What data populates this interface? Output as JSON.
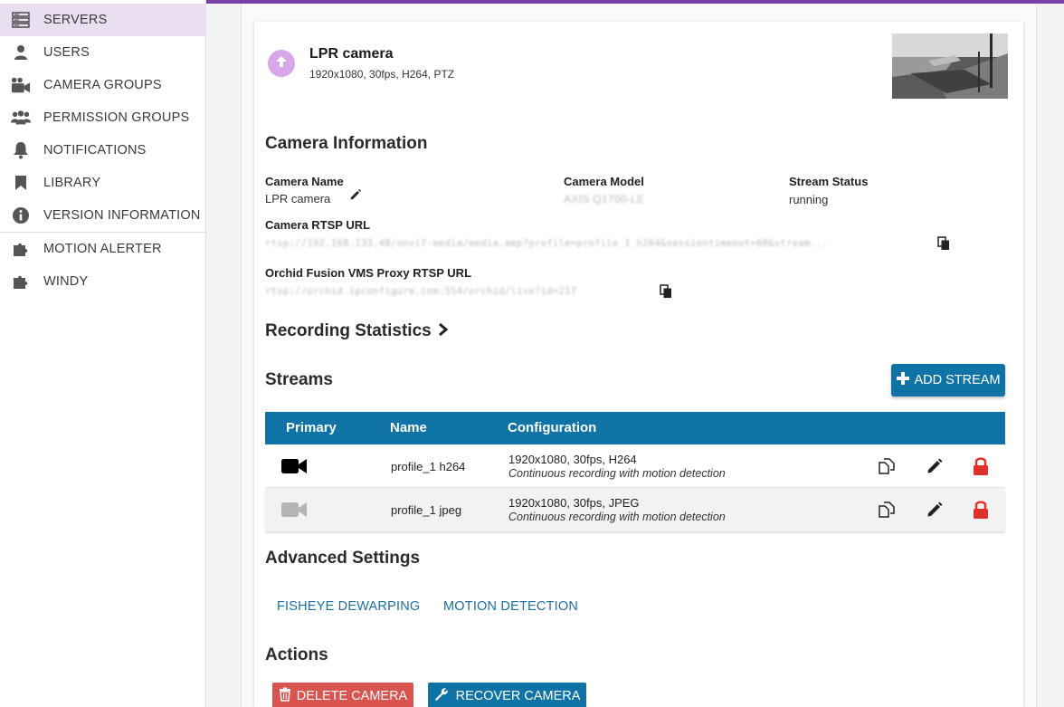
{
  "sidebar": {
    "items": [
      {
        "label": "SERVERS",
        "icon": "servers-icon",
        "active": true
      },
      {
        "label": "USERS",
        "icon": "user-icon"
      },
      {
        "label": "CAMERA GROUPS",
        "icon": "camera-groups-icon"
      },
      {
        "label": "PERMISSION GROUPS",
        "icon": "people-icon"
      },
      {
        "label": "NOTIFICATIONS",
        "icon": "bell-icon"
      },
      {
        "label": "LIBRARY",
        "icon": "bookmark-icon"
      },
      {
        "label": "VERSION INFORMATION",
        "icon": "info-icon"
      },
      {
        "label": "MOTION ALERTER",
        "icon": "puzzle-icon"
      },
      {
        "label": "WINDY",
        "icon": "puzzle-icon"
      }
    ]
  },
  "camera": {
    "name": "LPR camera",
    "summary": "1920x1080, 30fps, H264, PTZ"
  },
  "info": {
    "heading": "Camera Information",
    "name_label": "Camera Name",
    "name_value": "LPR camera",
    "model_label": "Camera Model",
    "model_value": "AXIS Q1700-LE",
    "status_label": "Stream Status",
    "status_value": "running",
    "rtsp_label": "Camera RTSP URL",
    "rtsp_value": "rtsp://192.168.133.48/onvif-media/media.amp?profile=profile_1_h264&sessiontimeout=60&stream...",
    "proxy_label": "Orchid Fusion VMS Proxy RTSP URL",
    "proxy_value": "rtsp://orchid.ipconfigure.com:554/orchid/live?id=217"
  },
  "recording": {
    "heading": "Recording Statistics",
    "chevron": ">"
  },
  "streams": {
    "heading": "Streams",
    "add_label": "ADD STREAM",
    "columns": [
      "Primary",
      "Name",
      "Configuration"
    ],
    "rows": [
      {
        "name": "profile_1 h264",
        "config": "1920x1080, 30fps, H264",
        "note": "Continuous recording with motion detection",
        "primary": true
      },
      {
        "name": "profile_1 jpeg",
        "config": "1920x1080, 30fps, JPEG",
        "note": "Continuous recording with motion detection",
        "primary": false
      }
    ]
  },
  "advanced": {
    "heading": "Advanced Settings",
    "fisheye": "FISHEYE DEWARPING",
    "motion": "MOTION DETECTION"
  },
  "actions": {
    "heading": "Actions",
    "delete": "DELETE CAMERA",
    "recover": "RECOVER CAMERA"
  },
  "colors": {
    "accent": "#0f73a5",
    "brand": "#7b3fa7",
    "danger": "#d9534f",
    "lock": "#e0302b"
  }
}
